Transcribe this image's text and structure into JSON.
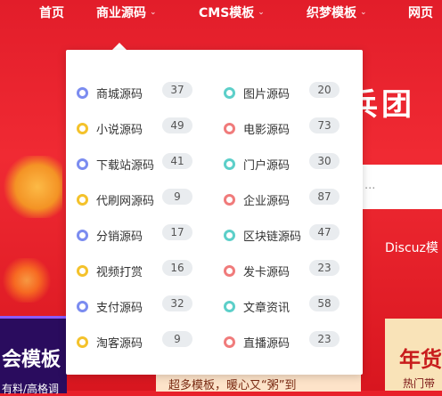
{
  "nav": [
    {
      "label": "首页",
      "dropdown": false
    },
    {
      "label": "商业源码",
      "dropdown": true
    },
    {
      "label": "CMS模板",
      "dropdown": true
    },
    {
      "label": "织梦模板",
      "dropdown": true
    },
    {
      "label": "网页",
      "dropdown": false
    }
  ],
  "hero": {
    "title": "兵团"
  },
  "search": {
    "placeholder": "..."
  },
  "discuz": "Discuz模",
  "cards": {
    "left_title": "会模板",
    "left_sub": "有料/高格调",
    "mid_text": "超多模板，暖心又“粥”到",
    "right_title": "年货",
    "right_sub": "热门带"
  },
  "dropdown": {
    "left": [
      {
        "label": "商城源码",
        "count": "37",
        "color": "#7b8cf0"
      },
      {
        "label": "小说源码",
        "count": "49",
        "color": "#f4c22b"
      },
      {
        "label": "下载站源码",
        "count": "41",
        "color": "#7b8cf0"
      },
      {
        "label": "代刷网源码",
        "count": "9",
        "color": "#f4c22b"
      },
      {
        "label": "分销源码",
        "count": "17",
        "color": "#7b8cf0"
      },
      {
        "label": "视频打赏",
        "count": "16",
        "color": "#f4c22b"
      },
      {
        "label": "支付源码",
        "count": "32",
        "color": "#7b8cf0"
      },
      {
        "label": "淘客源码",
        "count": "9",
        "color": "#f4c22b"
      }
    ],
    "right": [
      {
        "label": "图片源码",
        "count": "20",
        "color": "#5ccfc9"
      },
      {
        "label": "电影源码",
        "count": "73",
        "color": "#f07b7b"
      },
      {
        "label": "门户源码",
        "count": "30",
        "color": "#5ccfc9"
      },
      {
        "label": "企业源码",
        "count": "87",
        "color": "#f07b7b"
      },
      {
        "label": "区块链源码",
        "count": "47",
        "color": "#5ccfc9"
      },
      {
        "label": "发卡源码",
        "count": "23",
        "color": "#f07b7b"
      },
      {
        "label": "文章资讯",
        "count": "58",
        "color": "#5ccfc9"
      },
      {
        "label": "直播源码",
        "count": "23",
        "color": "#f07b7b"
      }
    ]
  }
}
